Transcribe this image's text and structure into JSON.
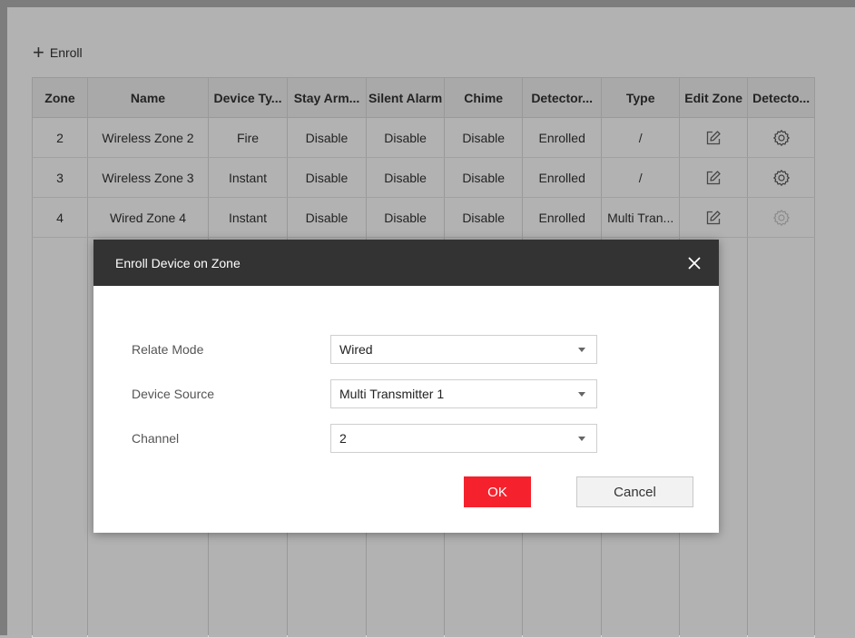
{
  "toolbar": {
    "enroll_icon": "plus-icon",
    "enroll_label": "Enroll"
  },
  "table": {
    "columns": [
      "Zone",
      "Name",
      "Device Ty...",
      "Stay Arm...",
      "Silent Alarm",
      "Chime",
      "Detector...",
      "Type",
      "Edit Zone",
      "Detecto..."
    ],
    "rows": [
      {
        "zone": "2",
        "name": "Wireless Zone 2",
        "device_type": "Fire",
        "stay_arm": "Disable",
        "silent_alarm": "Disable",
        "chime": "Disable",
        "detector": "Enrolled",
        "type": "/",
        "edit_icon": "edit-icon",
        "settings_icon": "gear-icon",
        "settings_enabled": true
      },
      {
        "zone": "3",
        "name": "Wireless Zone 3",
        "device_type": "Instant",
        "stay_arm": "Disable",
        "silent_alarm": "Disable",
        "chime": "Disable",
        "detector": "Enrolled",
        "type": "/",
        "edit_icon": "edit-icon",
        "settings_icon": "gear-icon",
        "settings_enabled": true
      },
      {
        "zone": "4",
        "name": "Wired Zone 4",
        "device_type": "Instant",
        "stay_arm": "Disable",
        "silent_alarm": "Disable",
        "chime": "Disable",
        "detector": "Enrolled",
        "type": "Multi Tran...",
        "edit_icon": "edit-icon",
        "settings_icon": "gear-icon",
        "settings_enabled": false
      }
    ]
  },
  "dialog": {
    "title": "Enroll Device on Zone",
    "close_icon": "close-icon",
    "fields": {
      "relate_mode": {
        "label": "Relate Mode",
        "value": "Wired"
      },
      "device_source": {
        "label": "Device Source",
        "value": "Multi Transmitter 1"
      },
      "channel": {
        "label": "Channel",
        "value": "2"
      }
    },
    "ok_label": "OK",
    "cancel_label": "Cancel"
  },
  "colors": {
    "header_bg": "#333333",
    "ok_button": "#f5222d",
    "overlay": "rgba(0,0,0,0.30)",
    "table_header_bg": "#f2f2f2"
  }
}
